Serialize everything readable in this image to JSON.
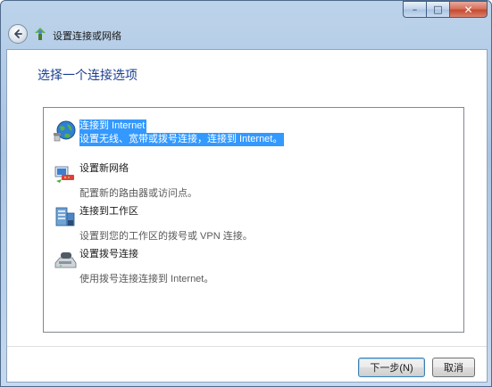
{
  "window": {
    "title": "设置连接或网络",
    "caption_buttons": {
      "minimize": "–",
      "maximize": "□",
      "close": "✕"
    }
  },
  "colors": {
    "heading": "#1b3f8f",
    "selection": "#3399ff",
    "frame": "#a9c4e2"
  },
  "main": {
    "heading": "选择一个连接选项",
    "options": [
      {
        "title": "连接到 Internet",
        "desc": "设置无线、宽带或拨号连接，连接到 Internet。",
        "icon": "globe-network-icon",
        "selected": true
      },
      {
        "title": "设置新网络",
        "desc": "配置新的路由器或访问点。",
        "icon": "router-setup-icon",
        "selected": false
      },
      {
        "title": "连接到工作区",
        "desc": "设置到您的工作区的拨号或 VPN 连接。",
        "icon": "workplace-connection-icon",
        "selected": false
      },
      {
        "title": "设置拨号连接",
        "desc": "使用拨号连接连接到 Internet。",
        "icon": "dialup-modem-icon",
        "selected": false
      }
    ]
  },
  "footer": {
    "next_label": "下一步(N)",
    "cancel_label": "取消"
  }
}
